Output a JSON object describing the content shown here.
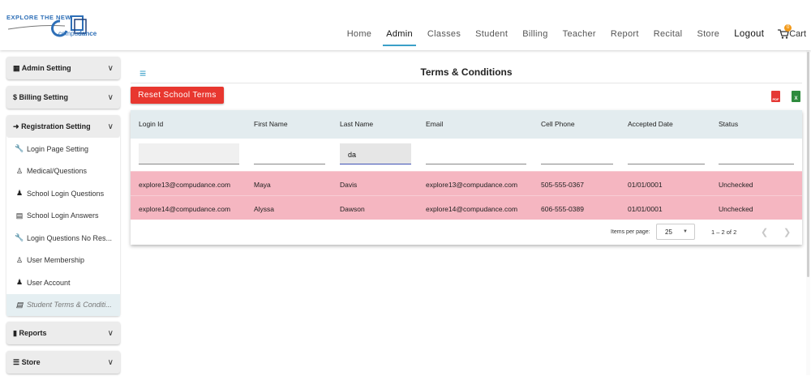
{
  "logo": {
    "tagline": "EXPLORE THE NEW",
    "brand_prefix": "compu",
    "brand_suffix": "dance"
  },
  "nav": {
    "items": [
      "Home",
      "Admin",
      "Classes",
      "Student",
      "Billing",
      "Teacher",
      "Report",
      "Recital",
      "Store"
    ],
    "active": "Admin",
    "logout": "Logout",
    "cart": "Cart",
    "cart_count": "0"
  },
  "sidebar": {
    "admin_setting": "Admin Setting",
    "billing_setting": "Billing Setting",
    "registration_setting": "Registration Setting",
    "registration_items": [
      {
        "label": "Login Page Setting",
        "icon": "wrench-icon"
      },
      {
        "label": "Medical/Questions",
        "icon": "user-icon"
      },
      {
        "label": "School Login Questions",
        "icon": "users-icon"
      },
      {
        "label": "School Login Answers",
        "icon": "list-icon"
      },
      {
        "label": "Login Questions No Res...",
        "icon": "wrench-icon"
      },
      {
        "label": "User Membership",
        "icon": "user-icon"
      },
      {
        "label": "User Account",
        "icon": "users-icon"
      },
      {
        "label": "Student Terms & Conditi...",
        "icon": "list-icon"
      }
    ],
    "reports": "Reports",
    "store": "Store"
  },
  "main": {
    "title": "Terms & Conditions",
    "reset_button": "Reset School Terms",
    "pdf_label": "PDF",
    "xls_label": "X"
  },
  "table": {
    "headers": [
      "Login Id",
      "First Name",
      "Last Name",
      "Email",
      "Cell Phone",
      "Accepted Date",
      "Status"
    ],
    "filter_last_name": "da",
    "rows": [
      [
        "explore13@compudance.com",
        "Maya",
        "Davis",
        "explore13@compudance.com",
        "505-555-0367",
        "01/01/0001",
        "Unchecked"
      ],
      [
        "explore14@compudance.com",
        "Alyssa",
        "Dawson",
        "explore14@compudance.com",
        "606-555-0389",
        "01/01/0001",
        "Unchecked"
      ]
    ],
    "row_color": "#f5b6c1"
  },
  "paginator": {
    "items_per_page_label": "Items per page:",
    "page_size": "25",
    "range": "1 – 2 of 2"
  },
  "colors": {
    "accent": "#3aa0c8",
    "danger": "#e8372f",
    "header_bg": "#e3ecef"
  }
}
